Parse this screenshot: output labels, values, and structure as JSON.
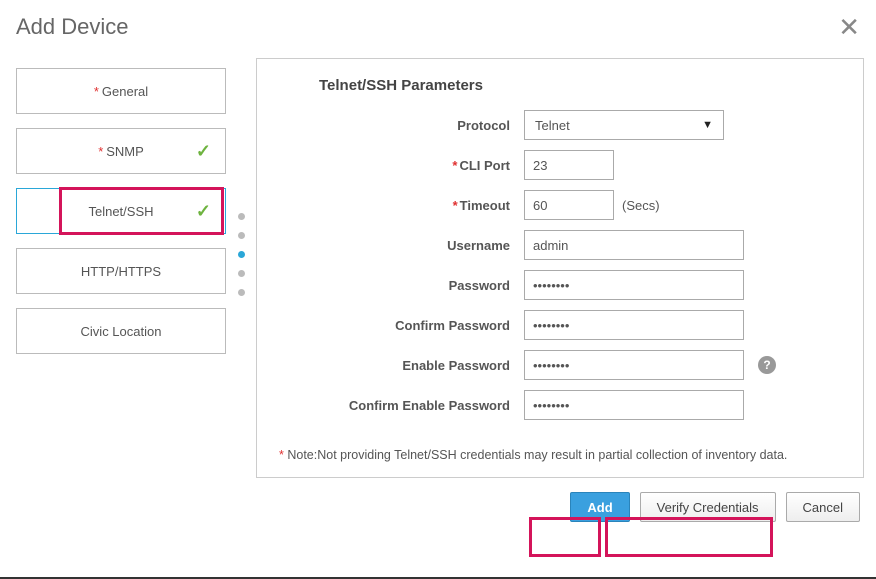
{
  "dialog": {
    "title": "Add Device"
  },
  "sidebar": {
    "items": [
      {
        "label": "General",
        "required": true,
        "checked": false,
        "active": false
      },
      {
        "label": "SNMP",
        "required": true,
        "checked": true,
        "active": false
      },
      {
        "label": "Telnet/SSH",
        "required": false,
        "checked": true,
        "active": true
      },
      {
        "label": "HTTP/HTTPS",
        "required": false,
        "checked": false,
        "active": false
      },
      {
        "label": "Civic Location",
        "required": false,
        "checked": false,
        "active": false
      }
    ]
  },
  "panel": {
    "heading": "Telnet/SSH Parameters",
    "protocol_label": "Protocol",
    "protocol_value": "Telnet",
    "cli_port_label": "CLI Port",
    "cli_port_value": "23",
    "timeout_label": "Timeout",
    "timeout_value": "60",
    "timeout_suffix": "(Secs)",
    "username_label": "Username",
    "username_value": "admin",
    "password_label": "Password",
    "password_value": "********",
    "confirm_password_label": "Confirm Password",
    "confirm_password_value": "********",
    "enable_password_label": "Enable Password",
    "enable_password_value": "********",
    "confirm_enable_password_label": "Confirm Enable Password",
    "confirm_enable_password_value": "********",
    "note_prefix": "* ",
    "note": "Note:Not providing Telnet/SSH credentials may result in partial collection of inventory data."
  },
  "footer": {
    "add": "Add",
    "verify": "Verify Credentials",
    "cancel": "Cancel"
  },
  "icons": {
    "close": "✕",
    "check": "✓",
    "help": "?",
    "triangle": "▼"
  }
}
